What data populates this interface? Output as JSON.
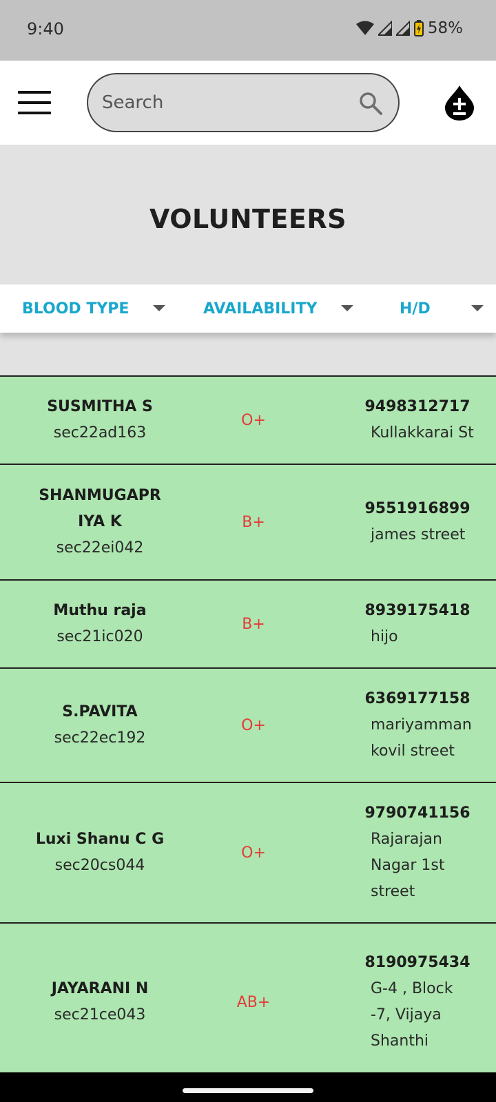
{
  "status_bar": {
    "time": "9:40",
    "battery": "58%",
    "icons": [
      "wifi-icon",
      "signal-icon",
      "signal-icon",
      "battery-charging-icon"
    ]
  },
  "header": {
    "search_placeholder": "Search",
    "icons": [
      "menu-icon",
      "search-icon",
      "blood-drop-plus-minus-icon"
    ]
  },
  "page": {
    "title": "VOLUNTEERS"
  },
  "filters": [
    {
      "label": "BLOOD TYPE"
    },
    {
      "label": "AVAILABILITY"
    },
    {
      "label": "H/D"
    }
  ],
  "colors": {
    "accent": "#19a7cc",
    "row_bg": "#ade6b0",
    "blood_text": "#e53b3b",
    "hero_bg": "#e2e2e2"
  },
  "volunteers": [
    {
      "name_lines": [
        "SUSMITHA S"
      ],
      "roll": "sec22ad163",
      "blood": "O+",
      "phone": "9498312717",
      "address_lines": [
        "Kullakkarai St"
      ]
    },
    {
      "name_lines": [
        "SHANMUGAPR",
        "IYA K"
      ],
      "roll": "sec22ei042",
      "blood": "B+",
      "phone": "9551916899",
      "address_lines": [
        "james street"
      ]
    },
    {
      "name_lines": [
        "Muthu raja"
      ],
      "roll": "sec21ic020",
      "blood": "B+",
      "phone": "8939175418",
      "address_lines": [
        "hijo"
      ]
    },
    {
      "name_lines": [
        "S.PAVITA"
      ],
      "roll": "sec22ec192",
      "blood": "O+",
      "phone": "6369177158",
      "address_lines": [
        "mariyamman",
        "kovil street"
      ]
    },
    {
      "name_lines": [
        "Luxi Shanu C G"
      ],
      "roll": "sec20cs044",
      "blood": "O+",
      "phone": "9790741156",
      "address_lines": [
        "Rajarajan",
        "Nagar 1st",
        "street"
      ]
    },
    {
      "name_lines": [
        "JAYARANI N"
      ],
      "roll": "sec21ce043",
      "blood": "AB+",
      "phone": "8190975434",
      "address_lines": [
        "G-4 , Block",
        "-7, Vijaya",
        "Shanthi"
      ]
    }
  ]
}
